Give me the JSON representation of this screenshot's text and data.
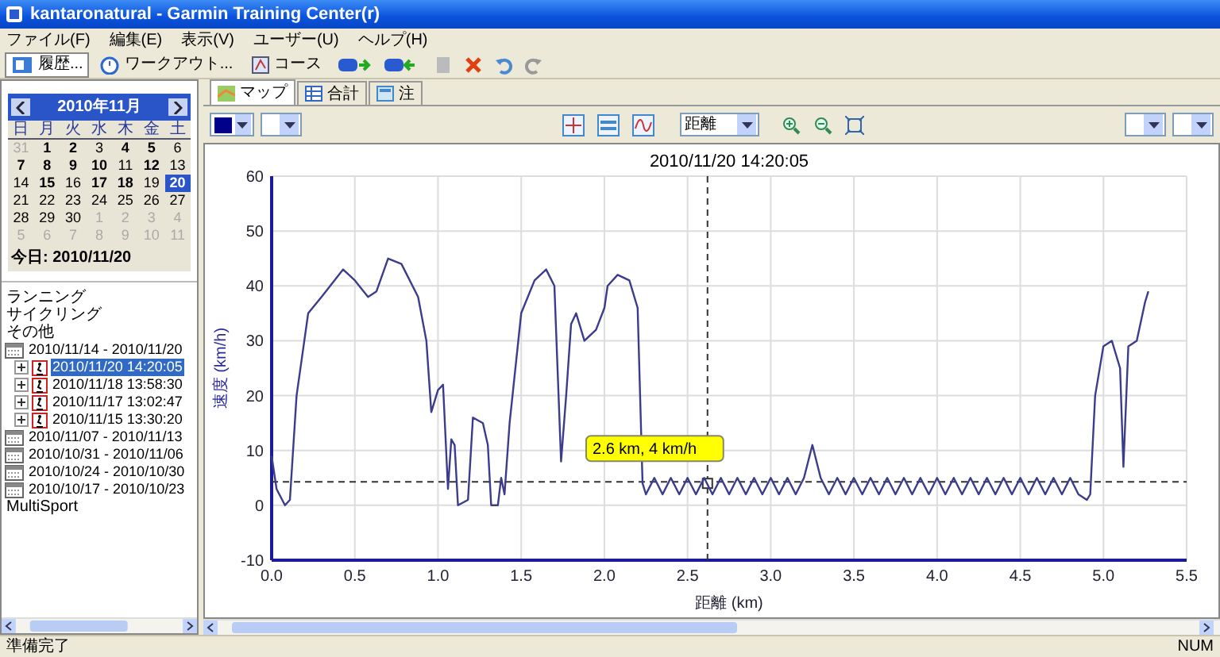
{
  "window": {
    "title": "kantaronatural - Garmin Training Center(r)"
  },
  "menu": [
    "ファイル(F)",
    "編集(E)",
    "表示(V)",
    "ユーザー(U)",
    "ヘルプ(H)"
  ],
  "toolbar": [
    {
      "label": "履歴...",
      "selected": true
    },
    {
      "label": "ワークアウト...",
      "selected": false
    },
    {
      "label": "コース",
      "selected": false
    }
  ],
  "calendar": {
    "month": "2010年11月",
    "weekdays": [
      "日",
      "月",
      "火",
      "水",
      "木",
      "金",
      "土"
    ],
    "weeks": [
      [
        {
          "day": "31",
          "muted": true,
          "active": false,
          "selected": false
        },
        {
          "day": "1",
          "muted": false,
          "active": true,
          "selected": false
        },
        {
          "day": "2",
          "muted": false,
          "active": true,
          "selected": false
        },
        {
          "day": "3",
          "muted": false,
          "active": false,
          "selected": false
        },
        {
          "day": "4",
          "muted": false,
          "active": true,
          "selected": false
        },
        {
          "day": "5",
          "muted": false,
          "active": true,
          "selected": false
        },
        {
          "day": "6",
          "muted": false,
          "active": false,
          "selected": false
        }
      ],
      [
        {
          "day": "7",
          "muted": false,
          "active": true,
          "selected": false
        },
        {
          "day": "8",
          "muted": false,
          "active": true,
          "selected": false
        },
        {
          "day": "9",
          "muted": false,
          "active": true,
          "selected": false
        },
        {
          "day": "10",
          "muted": false,
          "active": true,
          "selected": false
        },
        {
          "day": "11",
          "muted": false,
          "active": false,
          "selected": false
        },
        {
          "day": "12",
          "muted": false,
          "active": true,
          "selected": false
        },
        {
          "day": "13",
          "muted": false,
          "active": false,
          "selected": false
        }
      ],
      [
        {
          "day": "14",
          "muted": false,
          "active": false,
          "selected": false
        },
        {
          "day": "15",
          "muted": false,
          "active": true,
          "selected": false
        },
        {
          "day": "16",
          "muted": false,
          "active": false,
          "selected": false
        },
        {
          "day": "17",
          "muted": false,
          "active": true,
          "selected": false
        },
        {
          "day": "18",
          "muted": false,
          "active": true,
          "selected": false
        },
        {
          "day": "19",
          "muted": false,
          "active": false,
          "selected": false
        },
        {
          "day": "20",
          "muted": false,
          "active": true,
          "selected": true
        }
      ],
      [
        {
          "day": "21",
          "muted": false,
          "active": false,
          "selected": false
        },
        {
          "day": "22",
          "muted": false,
          "active": false,
          "selected": false
        },
        {
          "day": "23",
          "muted": false,
          "active": false,
          "selected": false
        },
        {
          "day": "24",
          "muted": false,
          "active": false,
          "selected": false
        },
        {
          "day": "25",
          "muted": false,
          "active": false,
          "selected": false
        },
        {
          "day": "26",
          "muted": false,
          "active": false,
          "selected": false
        },
        {
          "day": "27",
          "muted": false,
          "active": false,
          "selected": false
        }
      ],
      [
        {
          "day": "28",
          "muted": false,
          "active": false,
          "selected": false
        },
        {
          "day": "29",
          "muted": false,
          "active": false,
          "selected": false
        },
        {
          "day": "30",
          "muted": false,
          "active": false,
          "selected": false
        },
        {
          "day": "1",
          "muted": true,
          "active": false,
          "selected": false
        },
        {
          "day": "2",
          "muted": true,
          "active": false,
          "selected": false
        },
        {
          "day": "3",
          "muted": true,
          "active": false,
          "selected": false
        },
        {
          "day": "4",
          "muted": true,
          "active": false,
          "selected": false
        }
      ],
      [
        {
          "day": "5",
          "muted": true,
          "active": false,
          "selected": false
        },
        {
          "day": "6",
          "muted": true,
          "active": false,
          "selected": false
        },
        {
          "day": "7",
          "muted": true,
          "active": false,
          "selected": false
        },
        {
          "day": "8",
          "muted": true,
          "active": false,
          "selected": false
        },
        {
          "day": "9",
          "muted": true,
          "active": false,
          "selected": false
        },
        {
          "day": "10",
          "muted": true,
          "active": false,
          "selected": false
        },
        {
          "day": "11",
          "muted": true,
          "active": false,
          "selected": false
        }
      ]
    ],
    "today": "今日: 2010/11/20"
  },
  "tree": [
    {
      "kind": "category",
      "label": "ランニング",
      "selected": false
    },
    {
      "kind": "category",
      "label": "サイクリング",
      "selected": false
    },
    {
      "kind": "category",
      "label": "その他",
      "selected": false
    },
    {
      "kind": "week",
      "label": "2010/11/14 - 2010/11/20",
      "selected": false,
      "children": [
        {
          "kind": "activity",
          "label": "2010/11/20 14:20:05",
          "selected": true,
          "expanded": false
        },
        {
          "kind": "activity",
          "label": "2010/11/18 13:58:30",
          "selected": false,
          "expanded": false
        },
        {
          "kind": "activity",
          "label": "2010/11/17 13:02:47",
          "selected": false,
          "expanded": false
        },
        {
          "kind": "activity",
          "label": "2010/11/15 13:30:20",
          "selected": false,
          "expanded": false
        }
      ]
    },
    {
      "kind": "week",
      "label": "2010/11/07 - 2010/11/13",
      "selected": false
    },
    {
      "kind": "week",
      "label": "2010/10/31 - 2010/11/06",
      "selected": false
    },
    {
      "kind": "week",
      "label": "2010/10/24 - 2010/10/30",
      "selected": false
    },
    {
      "kind": "week",
      "label": "2010/10/17 - 2010/10/23",
      "selected": false
    },
    {
      "kind": "category",
      "label": "MultiSport",
      "selected": false
    }
  ],
  "tabs": [
    {
      "label": "マップ",
      "selected": true
    },
    {
      "label": "合計",
      "selected": false
    },
    {
      "label": "注",
      "selected": false
    }
  ],
  "chart_toolbar": {
    "axis_select": "距離"
  },
  "chart": {
    "chart_data": {
      "type": "line",
      "title": "2010/11/20 14:20:05",
      "xlabel": "距離 (km)",
      "ylabel": "速度 (km/h)",
      "xlim": [
        0,
        5.5
      ],
      "ylim": [
        -10,
        60
      ],
      "xticks": [
        {
          "value": 0,
          "label": "0.0"
        },
        {
          "value": 0.5,
          "label": "0.5"
        },
        {
          "value": 1,
          "label": "1.0"
        },
        {
          "value": 1.5,
          "label": "1.5"
        },
        {
          "value": 2,
          "label": "2.0"
        },
        {
          "value": 2.5,
          "label": "2.5"
        },
        {
          "value": 3,
          "label": "3.0"
        },
        {
          "value": 3.5,
          "label": "3.5"
        },
        {
          "value": 4,
          "label": "4.0"
        },
        {
          "value": 4.5,
          "label": "4.5"
        },
        {
          "value": 5,
          "label": "5.0"
        },
        {
          "value": 5.5,
          "label": "5.5"
        }
      ],
      "yticks": [
        -10,
        0,
        10,
        20,
        30,
        40,
        50,
        60
      ],
      "x": [
        0,
        0.03,
        0.08,
        0.11,
        0.15,
        0.22,
        0.3,
        0.43,
        0.5,
        0.58,
        0.63,
        0.7,
        0.78,
        0.88,
        0.93,
        0.96,
        1.0,
        1.03,
        1.06,
        1.08,
        1.1,
        1.12,
        1.18,
        1.21,
        1.27,
        1.3,
        1.32,
        1.36,
        1.38,
        1.4,
        1.43,
        1.5,
        1.58,
        1.65,
        1.7,
        1.74,
        1.77,
        1.8,
        1.83,
        1.88,
        1.95,
        2.0,
        2.02,
        2.08,
        2.15,
        2.2,
        2.23,
        2.25,
        2.3,
        2.35,
        2.4,
        2.45,
        2.5,
        2.55,
        2.6,
        2.65,
        2.7,
        2.75,
        2.8,
        2.85,
        2.9,
        2.95,
        3.0,
        3.05,
        3.1,
        3.15,
        3.2,
        3.25,
        3.3,
        3.35,
        3.4,
        3.45,
        3.5,
        3.55,
        3.6,
        3.65,
        3.7,
        3.75,
        3.8,
        3.85,
        3.9,
        3.95,
        4.0,
        4.05,
        4.1,
        4.15,
        4.2,
        4.25,
        4.3,
        4.35,
        4.4,
        4.45,
        4.5,
        4.55,
        4.6,
        4.65,
        4.7,
        4.75,
        4.8,
        4.85,
        4.9,
        4.92,
        4.95,
        5.0,
        5.05,
        5.1,
        5.12,
        5.15,
        5.2,
        5.25,
        5.27
      ],
      "series": [
        {
          "color": "#3c3c8c",
          "values": [
            9,
            3,
            0,
            1,
            20,
            35,
            38,
            43,
            41,
            38,
            39,
            45,
            44,
            38,
            30,
            17,
            21,
            22,
            3,
            12,
            11,
            0,
            1,
            16,
            15,
            11,
            0,
            0,
            5,
            2,
            15,
            35,
            41,
            43,
            40,
            8,
            20,
            33,
            35,
            30,
            32,
            36,
            40,
            42,
            41,
            36,
            4,
            2,
            5,
            2,
            5,
            2,
            5,
            2,
            5,
            2,
            5,
            2,
            5,
            2,
            5,
            2,
            5,
            2,
            5,
            2,
            5,
            11,
            5,
            2,
            5,
            2,
            5,
            2,
            5,
            2,
            5,
            2,
            5,
            2,
            5,
            2,
            5,
            2,
            5,
            2,
            5,
            2,
            5,
            2,
            5,
            2,
            5,
            2,
            5,
            2,
            5,
            2,
            5,
            2,
            1,
            2,
            20,
            29,
            30,
            25,
            7,
            29,
            30,
            37,
            39
          ]
        }
      ],
      "grid": true,
      "ref_lines": [
        {
          "axis": "y",
          "value": 4.3
        },
        {
          "axis": "x",
          "value": 2.62
        }
      ],
      "annotations": [
        {
          "x": 2.62,
          "y": 4,
          "text": "2.6 km, 4 km/h"
        }
      ]
    }
  },
  "status_bar": {
    "text": "準備完了",
    "indicator": "NUM"
  }
}
